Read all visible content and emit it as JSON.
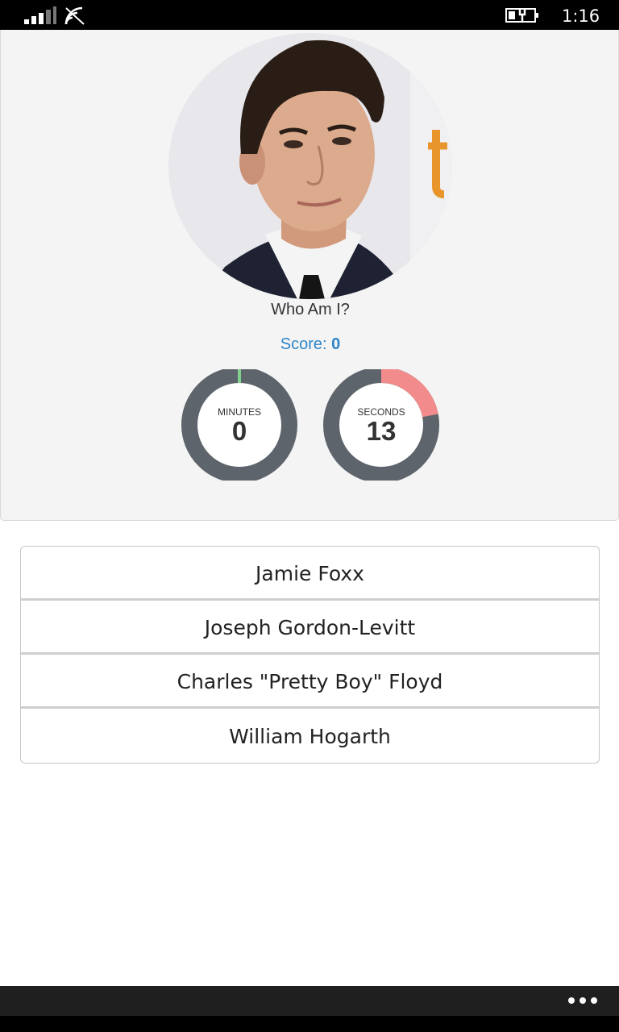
{
  "status_bar": {
    "time": "1:16",
    "icons": [
      "signal-icon",
      "wifi-icon",
      "battery-charging-icon"
    ]
  },
  "quiz": {
    "question": "Who Am I?",
    "score_label": "Score:",
    "score_value": "0",
    "timer": {
      "minutes_label": "MINUTES",
      "minutes_value": "0",
      "minutes_fraction": 0.0,
      "seconds_label": "SECONDS",
      "seconds_value": "13",
      "seconds_fraction": 0.22,
      "ring_color": "#5d646b",
      "minutes_accent": "#7fd18b",
      "seconds_accent": "#f28b8b"
    },
    "answers": [
      "Jamie Foxx",
      "Joseph Gordon-Levitt",
      "Charles \"Pretty Boy\" Floyd",
      "William Hogarth"
    ]
  },
  "app_bar": {
    "more_icon": "more-dots-icon"
  },
  "colors": {
    "accent": "#2f86c8",
    "card_bg": "#f4f4f4"
  }
}
